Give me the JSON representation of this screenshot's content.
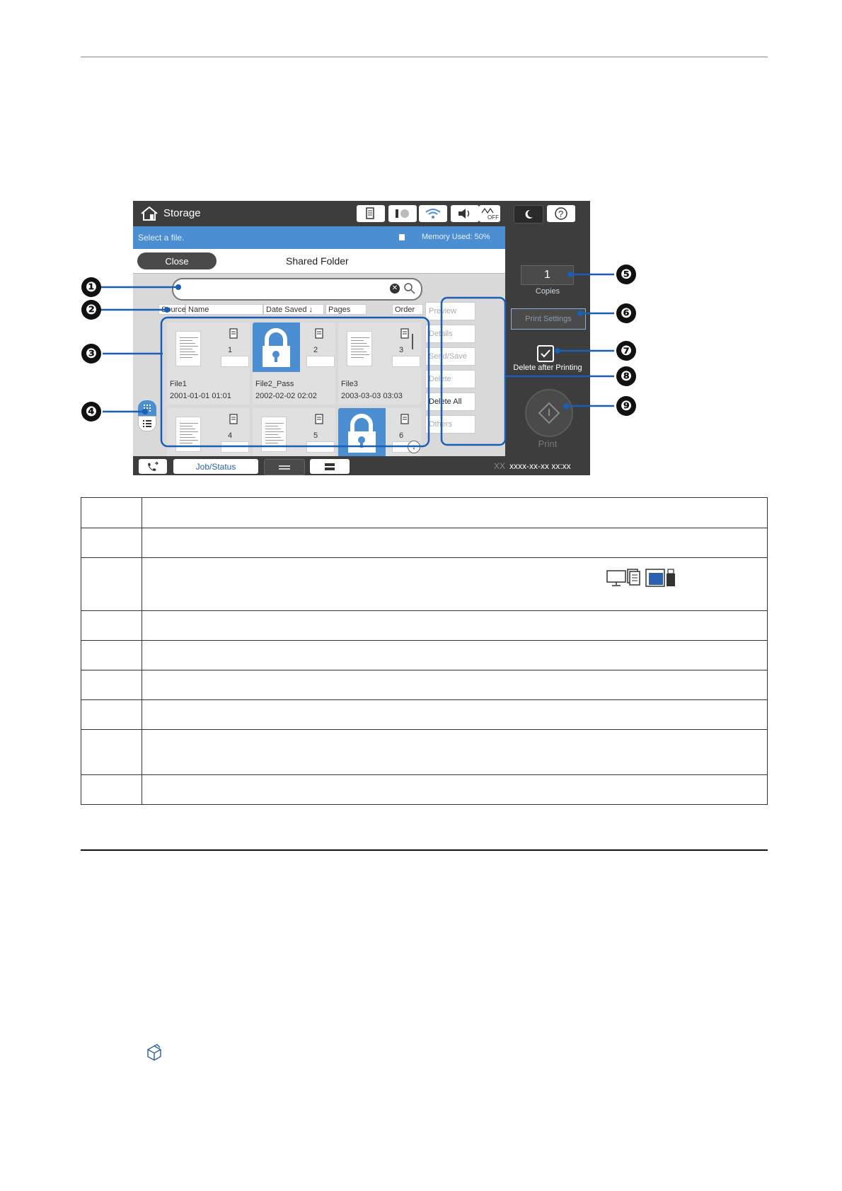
{
  "screen": {
    "title": "Storage",
    "info_text": "Select a file.",
    "memory_text": "Memory Used: 50%",
    "close_label": "Close",
    "folder_label": "Shared Folder",
    "columns": [
      "Source",
      "Name",
      "Date Saved",
      "Pages",
      "Order"
    ],
    "date_sort_arrow": "↓",
    "files": [
      {
        "name": "File1",
        "date": "2001-01-01 01:01",
        "pages": "1",
        "locked": false,
        "source_icon": "document-icon"
      },
      {
        "name": "File2_Pass",
        "date": "2002-02-02 02:02",
        "pages": "2",
        "locked": true,
        "source_icon": "memory-card-icon"
      },
      {
        "name": "File3",
        "date": "2003-03-03 03:03",
        "pages": "3",
        "locked": false,
        "source_icon": "computer-icon"
      },
      {
        "name": "",
        "date": "",
        "pages": "4",
        "locked": false,
        "source_icon": "document-icon"
      },
      {
        "name": "",
        "date": "",
        "pages": "5",
        "locked": false,
        "source_icon": "usb-memory-icon"
      },
      {
        "name": "",
        "date": "",
        "pages": "6",
        "locked": true,
        "source_icon": "document-icon"
      }
    ],
    "side_menu": [
      {
        "label": "Preview",
        "enabled": false
      },
      {
        "label": "Details",
        "enabled": false
      },
      {
        "label": "Send/Save",
        "enabled": false
      },
      {
        "label": "Delete",
        "enabled": false
      },
      {
        "label": "Delete All",
        "enabled": true
      },
      {
        "label": "Others",
        "enabled": false
      }
    ],
    "copies_value": "1",
    "copies_label": "Copies",
    "print_settings_label": "Print Settings",
    "delete_after_printing_label": "Delete after Printing",
    "print_label": "Print",
    "job_status_label": "Job/Status",
    "datetime_prefix": "XX",
    "datetime": "xxxx-xx-xx  xx:xx",
    "accent_color": "#4b8ed2"
  },
  "callouts": [
    "❶",
    "❷",
    "❸",
    "❹",
    "❺",
    "❻",
    "❼",
    "❽",
    "❾"
  ],
  "table_rows": 10,
  "source_icons": [
    "computer-icon",
    "document-icon",
    "memory-card-icon",
    "usb-memory-icon"
  ],
  "footer_icon": "package-icon"
}
